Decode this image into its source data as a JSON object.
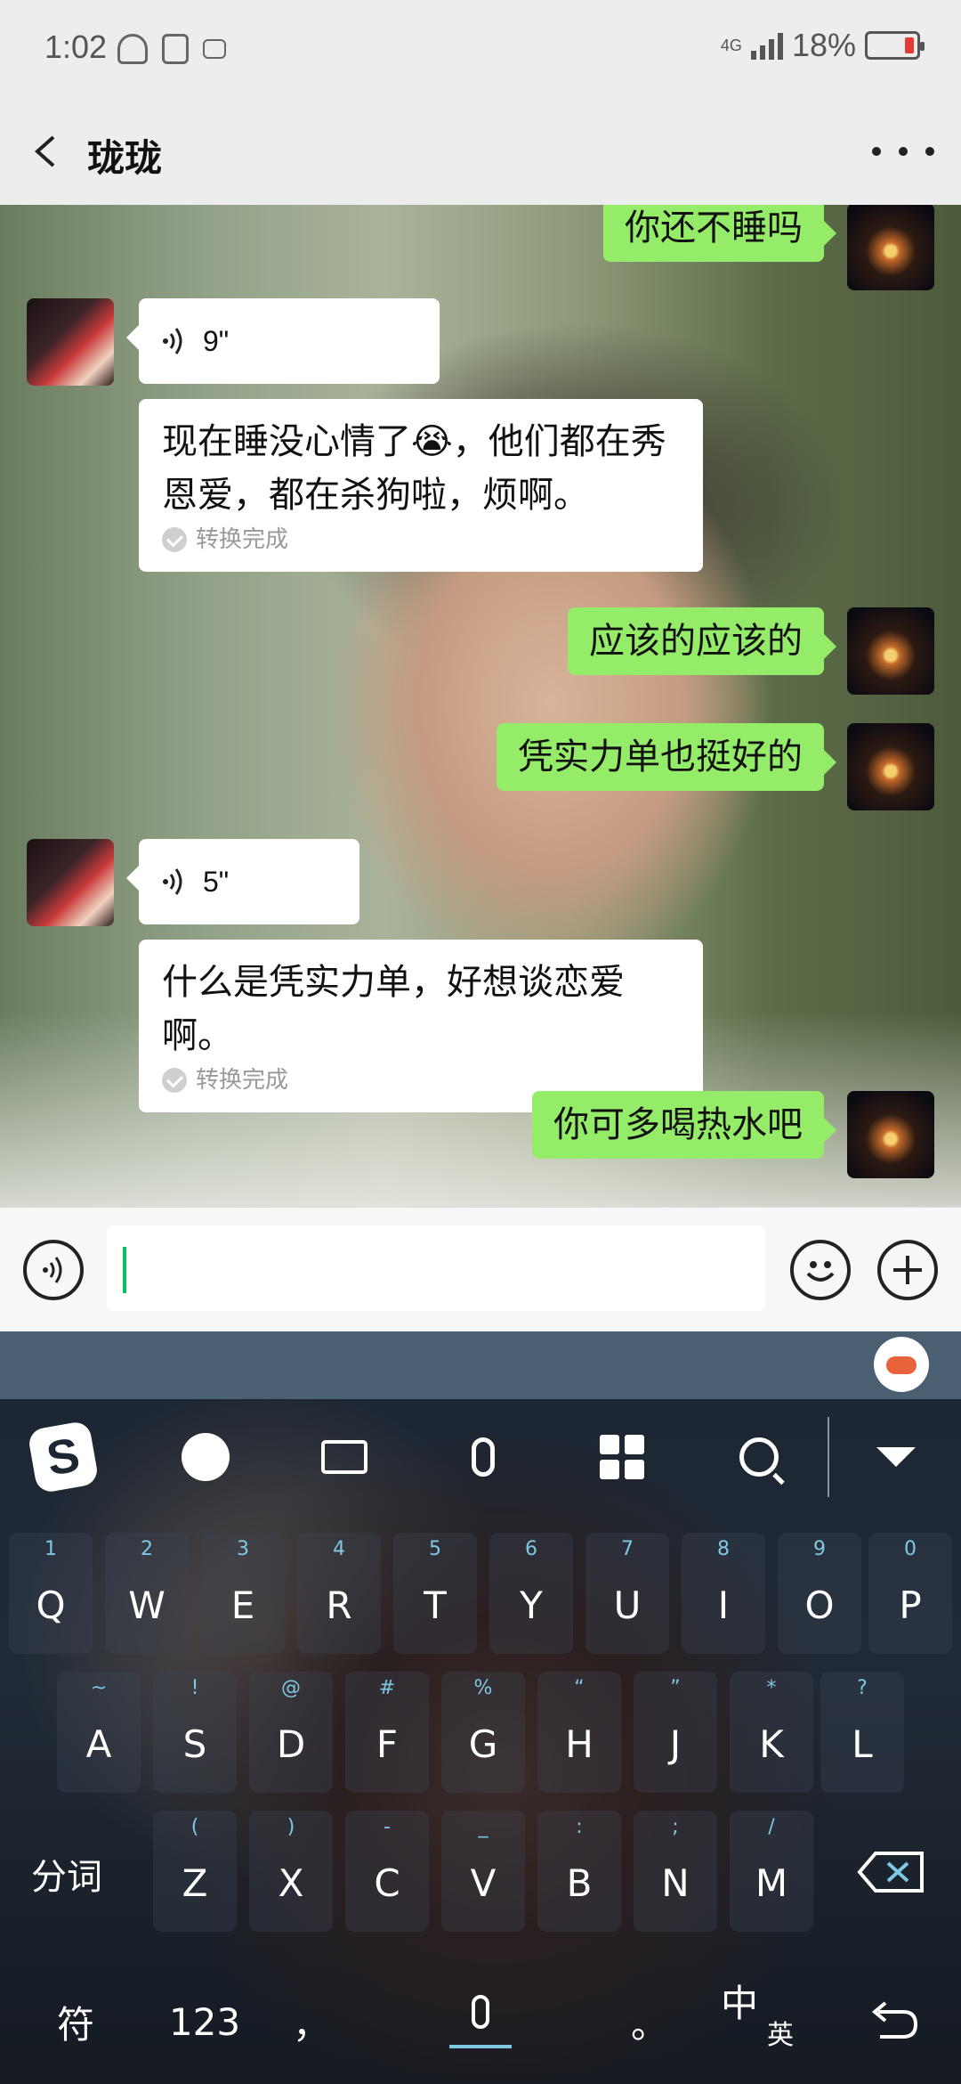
{
  "status_bar": {
    "time": "1:02",
    "network": "4G",
    "battery": "18%",
    "icons": [
      "mute-icon",
      "bluetooth-battery-icon",
      "keyboard-icon",
      "signal-icon",
      "battery-icon"
    ]
  },
  "header": {
    "title": "珑珑",
    "back_icon": "chevron-left-icon",
    "more_icon": "more-dots-icon"
  },
  "messages": [
    {
      "side": "me",
      "type": "text",
      "text": "你还不睡吗"
    },
    {
      "side": "other",
      "type": "voice",
      "duration": "9\"",
      "transcript": "现在睡没心情了😭，他们都在秀恩爱，都在杀狗啦，烦啊。",
      "status": "转换完成"
    },
    {
      "side": "me",
      "type": "text",
      "text": "应该的应该的"
    },
    {
      "side": "me",
      "type": "text",
      "text": "凭实力单也挺好的"
    },
    {
      "side": "other",
      "type": "voice",
      "duration": "5\"",
      "transcript": "什么是凭实力单，好想谈恋爱啊。",
      "status": "转换完成"
    },
    {
      "side": "me",
      "type": "text",
      "text": "你可多喝热水吧"
    }
  ],
  "input": {
    "value": "",
    "voice_icon": "voice-icon",
    "emoji_icon": "emoji-icon",
    "plus_icon": "plus-icon"
  },
  "keyboard": {
    "toolbar": [
      "sogou-logo-icon",
      "emoji-icon",
      "keyboard-icon",
      "mic-icon",
      "apps-grid-icon",
      "search-icon",
      "collapse-icon"
    ],
    "logo": "S",
    "row1": [
      {
        "k": "Q",
        "s": "1"
      },
      {
        "k": "W",
        "s": "2"
      },
      {
        "k": "E",
        "s": "3"
      },
      {
        "k": "R",
        "s": "4"
      },
      {
        "k": "T",
        "s": "5"
      },
      {
        "k": "Y",
        "s": "6"
      },
      {
        "k": "U",
        "s": "7"
      },
      {
        "k": "I",
        "s": "8"
      },
      {
        "k": "O",
        "s": "9"
      },
      {
        "k": "P",
        "s": "0"
      }
    ],
    "row2": [
      {
        "k": "A",
        "s": "~"
      },
      {
        "k": "S",
        "s": "!"
      },
      {
        "k": "D",
        "s": "@"
      },
      {
        "k": "F",
        "s": "#"
      },
      {
        "k": "G",
        "s": "%"
      },
      {
        "k": "H",
        "s": "“"
      },
      {
        "k": "J",
        "s": "”"
      },
      {
        "k": "K",
        "s": "*"
      },
      {
        "k": "L",
        "s": "?"
      }
    ],
    "row3": [
      {
        "k": "Z",
        "s": "("
      },
      {
        "k": "X",
        "s": ")"
      },
      {
        "k": "C",
        "s": "-"
      },
      {
        "k": "V",
        "s": "_"
      },
      {
        "k": "B",
        "s": ":"
      },
      {
        "k": "N",
        "s": ";"
      },
      {
        "k": "M",
        "s": "/"
      }
    ],
    "split_word": "分词",
    "symbols": "符",
    "numbers": "123",
    "comma": "，",
    "period": "。",
    "lang_cn": "中",
    "lang_en": "英",
    "enter_icon": "enter-icon",
    "backspace_icon": "backspace-icon"
  }
}
